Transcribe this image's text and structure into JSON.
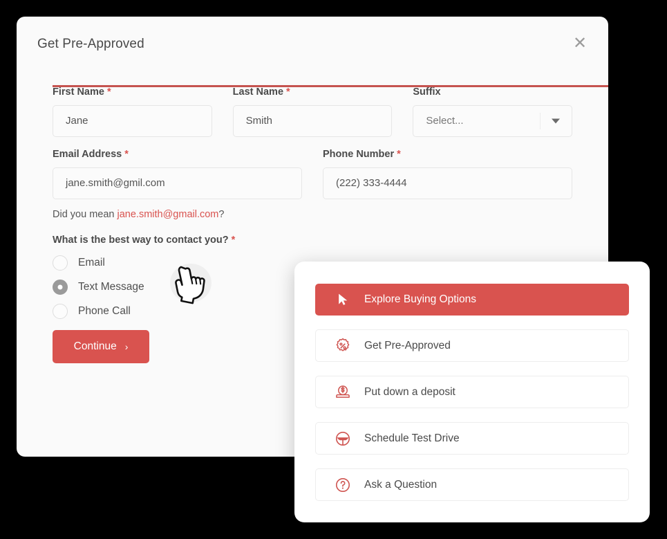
{
  "dialog": {
    "title": "Get Pre-Approved",
    "close_icon": "close-icon",
    "accent_color": "#d9534f"
  },
  "form": {
    "first_name": {
      "label": "First Name",
      "required": "*",
      "value": "Jane"
    },
    "last_name": {
      "label": "Last Name",
      "required": "*",
      "value": "Smith"
    },
    "suffix": {
      "label": "Suffix",
      "required": "",
      "value": "Select...",
      "caret_icon": "chevron-down-icon"
    },
    "email": {
      "label": "Email Address",
      "required": "*",
      "value": "jane.smith@gmil.com"
    },
    "phone": {
      "label": "Phone Number",
      "required": "*",
      "value": "(222) 333-4444"
    },
    "email_hint": {
      "prefix": "Did you mean ",
      "suggestion": "jane.smith@gmail.com",
      "suffix": "?"
    },
    "contact_question": {
      "label": "What is the best way to contact you?",
      "required": "*"
    },
    "contact_options": [
      {
        "label": "Email",
        "selected": false
      },
      {
        "label": "Text Message",
        "selected": true
      },
      {
        "label": "Phone Call",
        "selected": false
      }
    ],
    "continue_button": {
      "label": "Continue",
      "chevron": "›"
    }
  },
  "options_panel": {
    "items": [
      {
        "label": "Explore Buying Options",
        "icon": "cursor-arrow-icon",
        "primary": true
      },
      {
        "label": "Get Pre-Approved",
        "icon": "percent-badge-icon",
        "primary": false
      },
      {
        "label": "Put down a deposit",
        "icon": "coin-deposit-icon",
        "primary": false
      },
      {
        "label": "Schedule Test Drive",
        "icon": "steering-wheel-icon",
        "primary": false
      },
      {
        "label": "Ask a Question",
        "icon": "question-circle-icon",
        "primary": false
      }
    ]
  },
  "cursor": {
    "icon": "pointing-hand-cursor"
  }
}
